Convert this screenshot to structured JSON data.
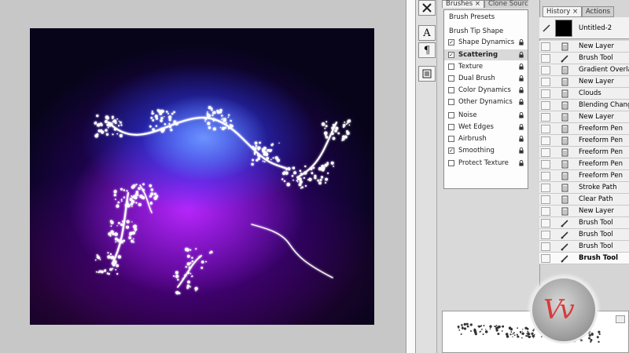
{
  "brushes_panel": {
    "tabs": [
      "Brushes ×",
      "Clone Source"
    ],
    "items": [
      {
        "label": "Brush Presets",
        "checkbox": false,
        "checked": false,
        "lock": false
      },
      {
        "label": "Brush Tip Shape",
        "checkbox": false,
        "checked": false,
        "lock": false
      },
      {
        "label": "Shape Dynamics",
        "checkbox": true,
        "checked": true,
        "lock": true
      },
      {
        "label": "Scattering",
        "checkbox": true,
        "checked": true,
        "lock": true,
        "selected": true
      },
      {
        "label": "Texture",
        "checkbox": true,
        "checked": false,
        "lock": true
      },
      {
        "label": "Dual Brush",
        "checkbox": true,
        "checked": false,
        "lock": true
      },
      {
        "label": "Color Dynamics",
        "checkbox": true,
        "checked": false,
        "lock": true
      },
      {
        "label": "Other Dynamics",
        "checkbox": true,
        "checked": false,
        "lock": true
      },
      {
        "label": "Noise",
        "checkbox": true,
        "checked": false,
        "lock": true
      },
      {
        "label": "Wet Edges",
        "checkbox": true,
        "checked": false,
        "lock": true
      },
      {
        "label": "Airbrush",
        "checkbox": true,
        "checked": false,
        "lock": true
      },
      {
        "label": "Smoothing",
        "checkbox": true,
        "checked": true,
        "lock": true
      },
      {
        "label": "Protect Texture",
        "checkbox": true,
        "checked": false,
        "lock": true
      }
    ]
  },
  "history_panel": {
    "tabs": [
      "History ×",
      "Actions"
    ],
    "snapshot": "Untitled-2",
    "items": [
      {
        "label": "New Layer",
        "icon": "document-icon"
      },
      {
        "label": "Brush Tool",
        "icon": "brush-icon"
      },
      {
        "label": "Gradient Overlay",
        "icon": "document-icon"
      },
      {
        "label": "New Layer",
        "icon": "document-icon"
      },
      {
        "label": "Clouds",
        "icon": "document-icon"
      },
      {
        "label": "Blending Change",
        "icon": "document-icon"
      },
      {
        "label": "New Layer",
        "icon": "document-icon"
      },
      {
        "label": "Freeform Pen",
        "icon": "document-icon"
      },
      {
        "label": "Freeform Pen",
        "icon": "document-icon"
      },
      {
        "label": "Freeform Pen",
        "icon": "document-icon"
      },
      {
        "label": "Freeform Pen",
        "icon": "document-icon"
      },
      {
        "label": "Freeform Pen",
        "icon": "document-icon"
      },
      {
        "label": "Stroke Path",
        "icon": "document-icon"
      },
      {
        "label": "Clear Path",
        "icon": "document-icon"
      },
      {
        "label": "New Layer",
        "icon": "document-icon"
      },
      {
        "label": "Brush Tool",
        "icon": "brush-icon"
      },
      {
        "label": "Brush Tool",
        "icon": "brush-icon"
      },
      {
        "label": "Brush Tool",
        "icon": "brush-icon"
      },
      {
        "label": "Brush Tool",
        "icon": "brush-icon",
        "current": true
      }
    ]
  },
  "tools": [
    "brush-settings-icon",
    "text-type-icon",
    "paragraph-icon",
    "layer-comps-icon"
  ],
  "logo_text": "Vv",
  "colors": {
    "accent_red": "#d83a3a",
    "canvas_bg": "#07041a",
    "glow_blue": "#2a46ff",
    "glow_purple": "#b428ff"
  }
}
